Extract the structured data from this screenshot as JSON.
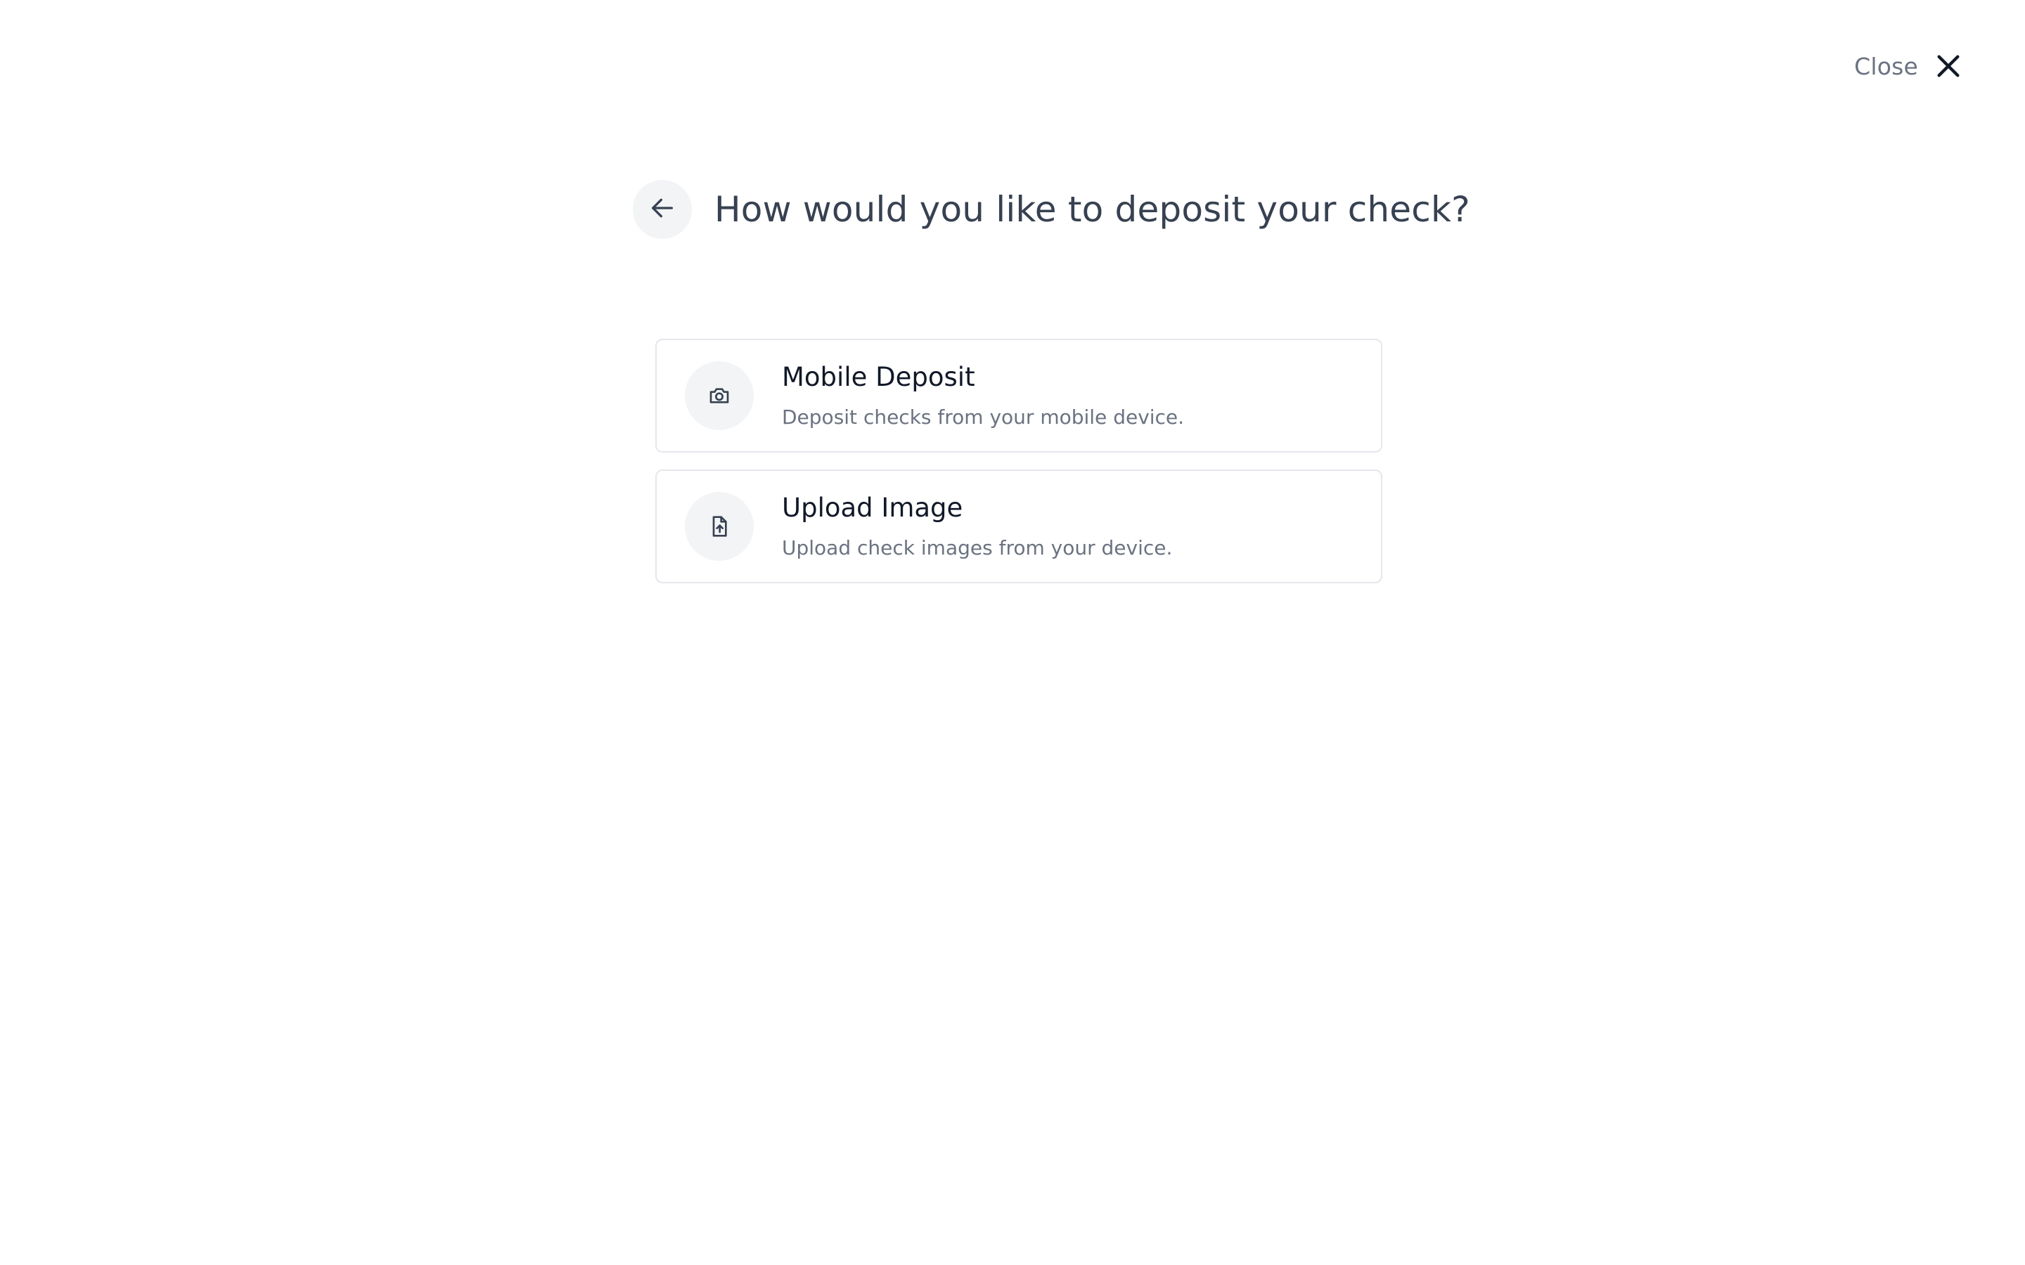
{
  "close": {
    "label": "Close",
    "icon": "close-icon"
  },
  "header": {
    "back_icon": "arrow-left-icon",
    "title": "How would you like to deposit your check?"
  },
  "options": [
    {
      "title": "Mobile Deposit",
      "description": "Deposit checks from your mobile device.",
      "icon": "camera-icon"
    },
    {
      "title": "Upload Image",
      "description": "Upload check images from your device.",
      "icon": "file-upload-icon"
    }
  ],
  "colors": {
    "title_text": "#374151",
    "muted_text": "#6b7280",
    "primary_text": "#111827",
    "icon_bg": "#f3f4f6",
    "card_border": "#e5e7eb"
  }
}
